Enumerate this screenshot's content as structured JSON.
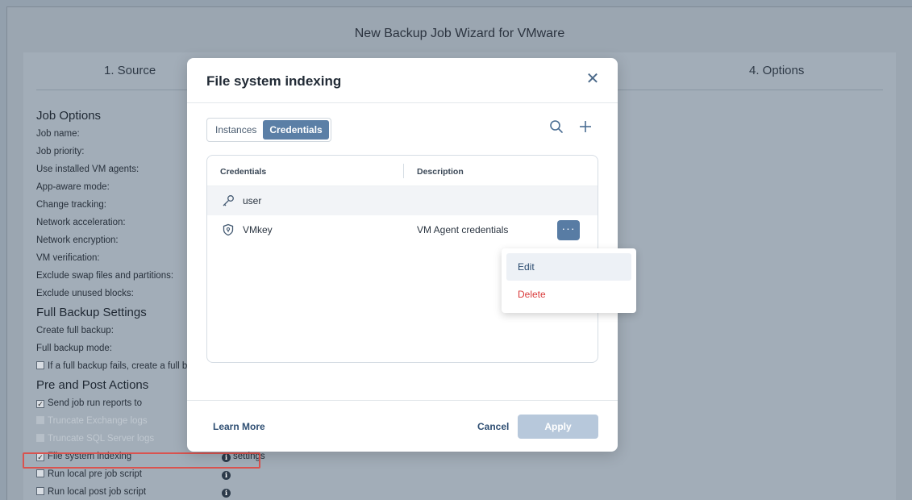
{
  "wizard": {
    "title": "New Backup Job Wizard for VMware",
    "steps": [
      "1. Source",
      "4. Options"
    ],
    "sections": {
      "job_options": "Job Options",
      "full_backup": "Full Backup Settings",
      "pre_post": "Pre and Post Actions"
    },
    "job_options": [
      "Job name:",
      "Job priority:",
      "Use installed VM agents:",
      "App-aware mode:",
      "Change tracking:",
      "Network acceleration:",
      "Network encryption:",
      "VM verification:",
      "Exclude swap files and partitions:",
      "Exclude unused blocks:"
    ],
    "full_backup": {
      "create_full": "Create full backup:",
      "mode": "Full backup mode:",
      "fail_option": "If a full backup fails, create a full b"
    },
    "actions": {
      "send_reports": "Send job run reports to",
      "truncate_exchange": "Truncate Exchange logs",
      "truncate_sql": "Truncate SQL Server logs",
      "fs_indexing": "File system indexing",
      "fs_indexing_link": "settings",
      "pre_script": "Run local pre job script",
      "post_script": "Run local post job script"
    }
  },
  "modal": {
    "title": "File system indexing",
    "tabs": [
      "Instances",
      "Credentials"
    ],
    "active_tab": "Credentials",
    "columns": [
      "Credentials",
      "Description"
    ],
    "rows": [
      {
        "name": "user",
        "description": "",
        "icon": "key-icon"
      },
      {
        "name": "VMkey",
        "description": "VM Agent credentials",
        "icon": "shield-icon"
      }
    ],
    "footer": {
      "learn_more": "Learn More",
      "cancel": "Cancel",
      "apply": "Apply"
    },
    "menu": {
      "edit": "Edit",
      "delete": "Delete"
    }
  },
  "colors": {
    "accent": "#587ca4",
    "delete": "#d93a3a",
    "highlight": "#d9534f"
  }
}
